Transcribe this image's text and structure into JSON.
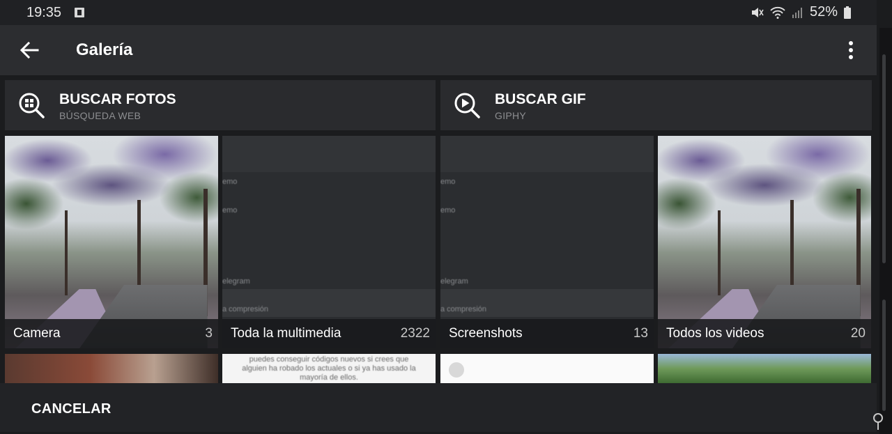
{
  "status_bar": {
    "time": "19:35",
    "battery": "52%",
    "icons": [
      "notification-icon",
      "mute-icon",
      "wifi-icon",
      "signal-icon",
      "battery-icon"
    ]
  },
  "app_bar": {
    "title": "Galería"
  },
  "search_cards": [
    {
      "title": "BUSCAR FOTOS",
      "subtitle": "BÚSQUEDA WEB",
      "icon": "search-grid-icon"
    },
    {
      "title": "BUSCAR GIF",
      "subtitle": "GIPHY",
      "icon": "search-play-icon"
    }
  ],
  "albums": [
    {
      "label": "Camera",
      "count": "3"
    },
    {
      "label": "Toda la multimedia",
      "count": "2322"
    },
    {
      "label": "Screenshots",
      "count": "13"
    },
    {
      "label": "Todos los videos",
      "count": "20"
    }
  ],
  "screenshot_preview": {
    "line1": "emo",
    "line2": "emo",
    "line3": "elegram",
    "line4": "a compresión"
  },
  "row2_preview_text": "puedes conseguir códigos nuevos si crees que alguien ha robado los actuales o si ya has usado la mayoría de ellos.",
  "bottom_bar": {
    "cancel_label": "CANCELAR"
  },
  "colors": {
    "background": "#1b1c1e",
    "app_bar": "#2c2d30",
    "card": "#2a2b2e"
  }
}
